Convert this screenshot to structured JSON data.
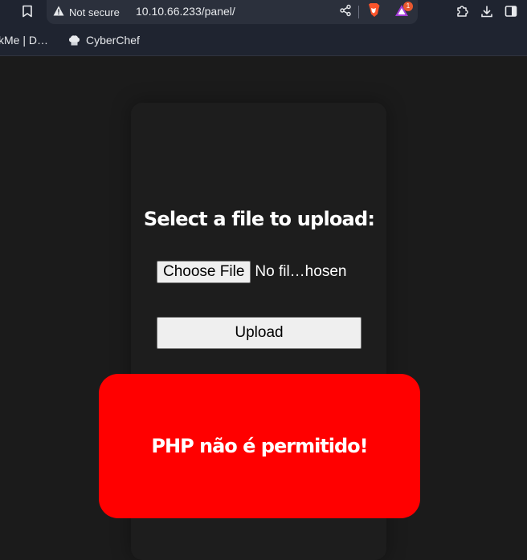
{
  "browser": {
    "security_label": "Not secure",
    "url": "10.10.66.233/panel/",
    "shields_badge": "1",
    "icons": [
      "bookmark-icon",
      "warning-icon",
      "share-icon",
      "brave-shields-icon",
      "brave-rewards-icon",
      "extensions-icon",
      "download-icon",
      "sidebar-icon"
    ]
  },
  "bookmarks": {
    "items": [
      {
        "label": "kMe | D…"
      },
      {
        "label": "CyberChef",
        "icon": "chef-hat-icon"
      }
    ]
  },
  "page": {
    "heading": "Select a file to upload:",
    "choose_file_label": "Choose File",
    "file_status": "No fil…hosen",
    "upload_label": "Upload",
    "error_message": "PHP não é permitido!",
    "colors": {
      "background": "#1b1b1b",
      "error_background": "#ff0000",
      "text": "#ffffff"
    }
  }
}
